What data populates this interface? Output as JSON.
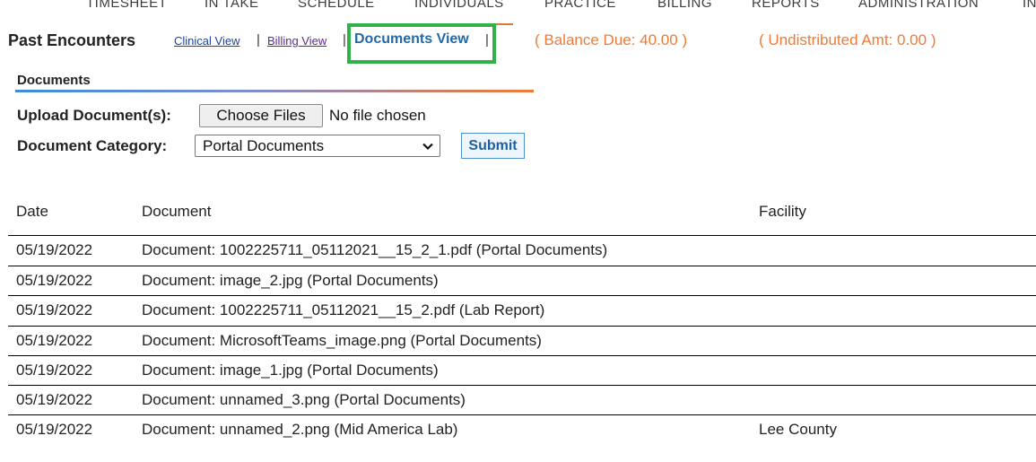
{
  "nav": {
    "items": [
      "TIMESHEET",
      "IN TAKE",
      "SCHEDULE",
      "INDIVIDUALS",
      "PRACTICE",
      "BILLING",
      "REPORTS",
      "ADMINISTRATION",
      "IN"
    ]
  },
  "header": {
    "title": "Past Encounters",
    "views": {
      "clinical": "Clinical View",
      "billing": "Billing View",
      "documents": "Documents View"
    },
    "separator": "|",
    "balance_due": "( Balance Due: 40.00 )",
    "undistributed": "( Undistributed Amt: 0.00 )"
  },
  "documents_section": {
    "title": "Documents",
    "upload_label": "Upload Document(s):",
    "choose_files_label": "Choose Files",
    "file_status": "No file chosen",
    "category_label": "Document Category:",
    "category_selected": "Portal Documents",
    "submit_label": "Submit"
  },
  "table": {
    "columns": [
      "Date",
      "Document",
      "Facility"
    ],
    "rows": [
      {
        "date": "05/19/2022",
        "document": "Document: 1002225711_05112021__15_2_1.pdf (Portal Documents)",
        "facility": ""
      },
      {
        "date": "05/19/2022",
        "document": "Document: image_2.jpg (Portal Documents)",
        "facility": ""
      },
      {
        "date": "05/19/2022",
        "document": "Document: 1002225711_05112021__15_2.pdf (Lab Report)",
        "facility": ""
      },
      {
        "date": "05/19/2022",
        "document": "Document: MicrosoftTeams_image.png (Portal Documents)",
        "facility": ""
      },
      {
        "date": "05/19/2022",
        "document": "Document: image_1.jpg (Portal Documents)",
        "facility": ""
      },
      {
        "date": "05/19/2022",
        "document": "Document: unnamed_3.png (Portal Documents)",
        "facility": ""
      },
      {
        "date": "05/19/2022",
        "document": "Document: unnamed_2.png (Mid America Lab)",
        "facility": "Lee County"
      }
    ]
  },
  "colors": {
    "accent_orange": "#ee7b35",
    "link_blue": "#1a44a8",
    "active_view": "#2369a8",
    "highlight_green": "#2fb24a"
  }
}
